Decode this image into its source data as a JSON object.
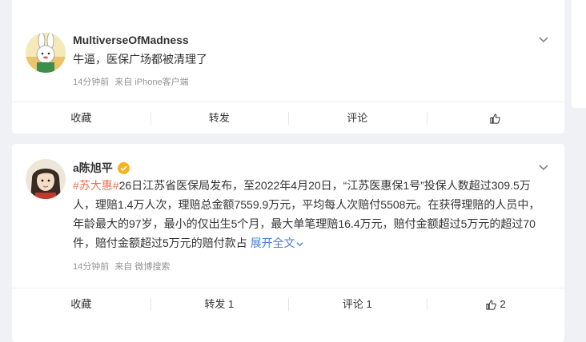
{
  "post1": {
    "user": "MultiverseOfMadness",
    "text": "牛逼，医保广场都被清理了",
    "time": "14分钟前",
    "source": "来自 iPhone客户端",
    "actions": {
      "fav": "收藏",
      "repost": "转发",
      "comment": "评论",
      "like": ""
    }
  },
  "post2": {
    "user": "a陈旭平",
    "hashtag": "#苏大惠#",
    "text_line1": "26日江苏省医保局发布，至2022年4月20日，“江苏医惠保1号”投保人数超过309.5万",
    "text_line2": "人，理赔1.4万人次，理赔总金额7559.9万元，平均每人次赔付5508元。在获得理赔的人员中，",
    "text_line3": "年龄最大的97岁，最小的仅出生5个月，最大单笔理赔16.4万元，赔付金额超过5万元的超过70",
    "text_line4": "件，赔付金额超过5万元的赔付款占",
    "expand": "展开全文",
    "time": "14分钟前",
    "source": "来自 微博搜索",
    "actions": {
      "fav": "收藏",
      "repost": "转发 1",
      "comment": "评论 1",
      "like": "2"
    }
  },
  "colors": {
    "hashtag": "#eb7350",
    "link": "#4b7dd4",
    "verified": "#f9b21d"
  }
}
